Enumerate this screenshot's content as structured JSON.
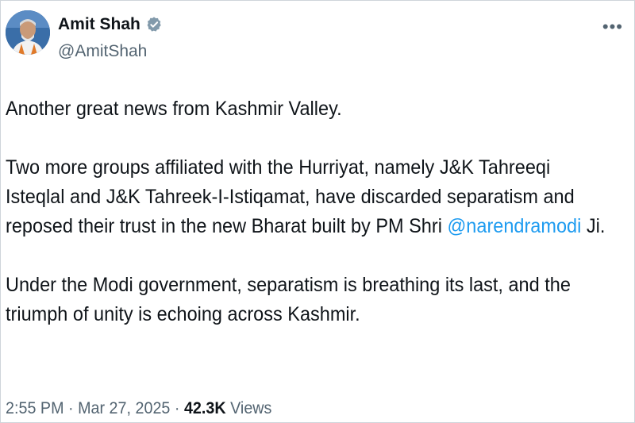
{
  "author": {
    "display_name": "Amit Shah",
    "handle": "@AmitShah",
    "verified_icon": "verified-badge-icon",
    "avatar_icon": "avatar-photo"
  },
  "menu": {
    "more_label": "•••"
  },
  "tweet": {
    "line1": "Another great news from Kashmir Valley.",
    "line2": "Two more groups affiliated with the Hurriyat, namely J&K Tahreeqi",
    "line3": "Isteqlal and J&K Tahreek-I-Istiqamat, have discarded separatism and",
    "line4_before": "reposed their trust in the new Bharat built by PM Shri ",
    "mention": "@narendramodi",
    "line4_after": " Ji.",
    "line5": "Under the Modi government, separatism is breathing its last, and the",
    "line6": "triumph of unity is echoing across Kashmir."
  },
  "meta": {
    "time": "2:55 PM",
    "sep1": " · ",
    "date": "Mar 27, 2025",
    "sep2": " · ",
    "views_count": "42.3K",
    "views_label": " Views"
  },
  "colors": {
    "accent": "#1d9bf0",
    "text": "#0f1419",
    "muted": "#536471"
  }
}
